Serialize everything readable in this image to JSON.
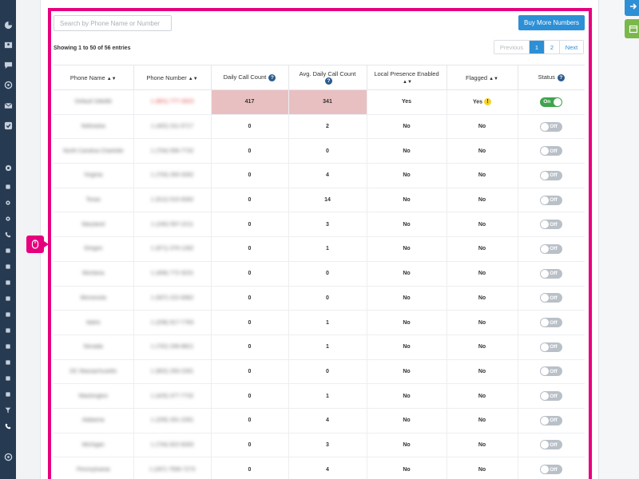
{
  "search": {
    "placeholder": "Search by Phone Name or Number"
  },
  "buy_button": "Buy More Numbers",
  "showing": "Showing 1 to 50 of 56 entries",
  "pagination": {
    "previous": "Previous",
    "pages": [
      "1",
      "2"
    ],
    "current": "1",
    "next": "Next"
  },
  "table": {
    "headers": {
      "phone_name": "Phone Name",
      "phone_number": "Phone Number",
      "daily_call_count": "Daily Call Count",
      "avg_daily_call_count": "Avg. Daily Call Count",
      "local_presence": "Local Presence Enabled",
      "flagged": "Flagged",
      "status": "Status"
    },
    "help_glyph": "?",
    "flag_glyph": "!",
    "rows": [
      {
        "name": "Default Sdkdfd",
        "number": "1 (801) 777-3323",
        "daily": "417",
        "avg": "341",
        "local": "Yes",
        "flagged": "Yes",
        "flag_icon": true,
        "status": "On",
        "highlight": true
      },
      {
        "name": "Nebraska",
        "number": "1 (402) 311-5717",
        "daily": "0",
        "avg": "2",
        "local": "No",
        "flagged": "No",
        "status": "Off"
      },
      {
        "name": "North Carolina Charlotte",
        "number": "1 (704) 556-7732",
        "daily": "0",
        "avg": "0",
        "local": "No",
        "flagged": "No",
        "status": "Off"
      },
      {
        "name": "Virginia",
        "number": "1 (703) 283-3282",
        "daily": "0",
        "avg": "4",
        "local": "No",
        "flagged": "No",
        "status": "Off"
      },
      {
        "name": "Texas",
        "number": "1 (512) 515-9282",
        "daily": "0",
        "avg": "14",
        "local": "No",
        "flagged": "No",
        "status": "Off"
      },
      {
        "name": "Maryland",
        "number": "1 (240) 597-2211",
        "daily": "0",
        "avg": "3",
        "local": "No",
        "flagged": "No",
        "status": "Off"
      },
      {
        "name": "Oregon",
        "number": "1 (971) 379-1282",
        "daily": "0",
        "avg": "1",
        "local": "No",
        "flagged": "No",
        "status": "Off"
      },
      {
        "name": "Montana",
        "number": "1 (406) 772-3231",
        "daily": "0",
        "avg": "0",
        "local": "No",
        "flagged": "No",
        "status": "Off"
      },
      {
        "name": "Minnesota",
        "number": "1 (507) 222-8362",
        "daily": "0",
        "avg": "0",
        "local": "No",
        "flagged": "No",
        "status": "Off"
      },
      {
        "name": "Idaho",
        "number": "1 (208) 917-7783",
        "daily": "0",
        "avg": "1",
        "local": "No",
        "flagged": "No",
        "status": "Off"
      },
      {
        "name": "Nevada",
        "number": "1 (702) 208-8821",
        "daily": "0",
        "avg": "1",
        "local": "No",
        "flagged": "No",
        "status": "Off"
      },
      {
        "name": "DC Massachusetts",
        "number": "1 (802) 293-2281",
        "daily": "0",
        "avg": "0",
        "local": "No",
        "flagged": "No",
        "status": "Off"
      },
      {
        "name": "Washington",
        "number": "1 (425) 377-7732",
        "daily": "0",
        "avg": "1",
        "local": "No",
        "flagged": "No",
        "status": "Off"
      },
      {
        "name": "Alabama",
        "number": "1 (205) 331-2281",
        "daily": "0",
        "avg": "4",
        "local": "No",
        "flagged": "No",
        "status": "Off"
      },
      {
        "name": "Michigan",
        "number": "1 (734) 822-8283",
        "daily": "0",
        "avg": "3",
        "local": "No",
        "flagged": "No",
        "status": "Off"
      },
      {
        "name": "Pennsylvania",
        "number": "1 (267) 7556-7273",
        "daily": "0",
        "avg": "4",
        "local": "No",
        "flagged": "No",
        "status": "Off"
      }
    ]
  },
  "sidebar_icons": [
    "pie-chart-icon",
    "contacts-icon",
    "chat-icon",
    "sync-icon",
    "mail-icon",
    "check-icon",
    "settings-icon",
    "building-icon",
    "cog-icon",
    "cogs-icon",
    "phone-icon",
    "image-icon",
    "magic-icon",
    "tag-icon",
    "exchange-icon",
    "pen-icon",
    "sliders-icon",
    "code-icon",
    "code-brackets-icon",
    "clock-icon",
    "cloud-icon",
    "filter-icon",
    "phone-volume-icon",
    "lifebuoy-icon"
  ],
  "colors": {
    "accent": "#2d8fd5",
    "frame": "#e6007e",
    "sidebar": "#263a52",
    "highlight": "#e8c0c2",
    "toggle_on": "#3fa44d",
    "toggle_off": "#b9c0c8"
  }
}
